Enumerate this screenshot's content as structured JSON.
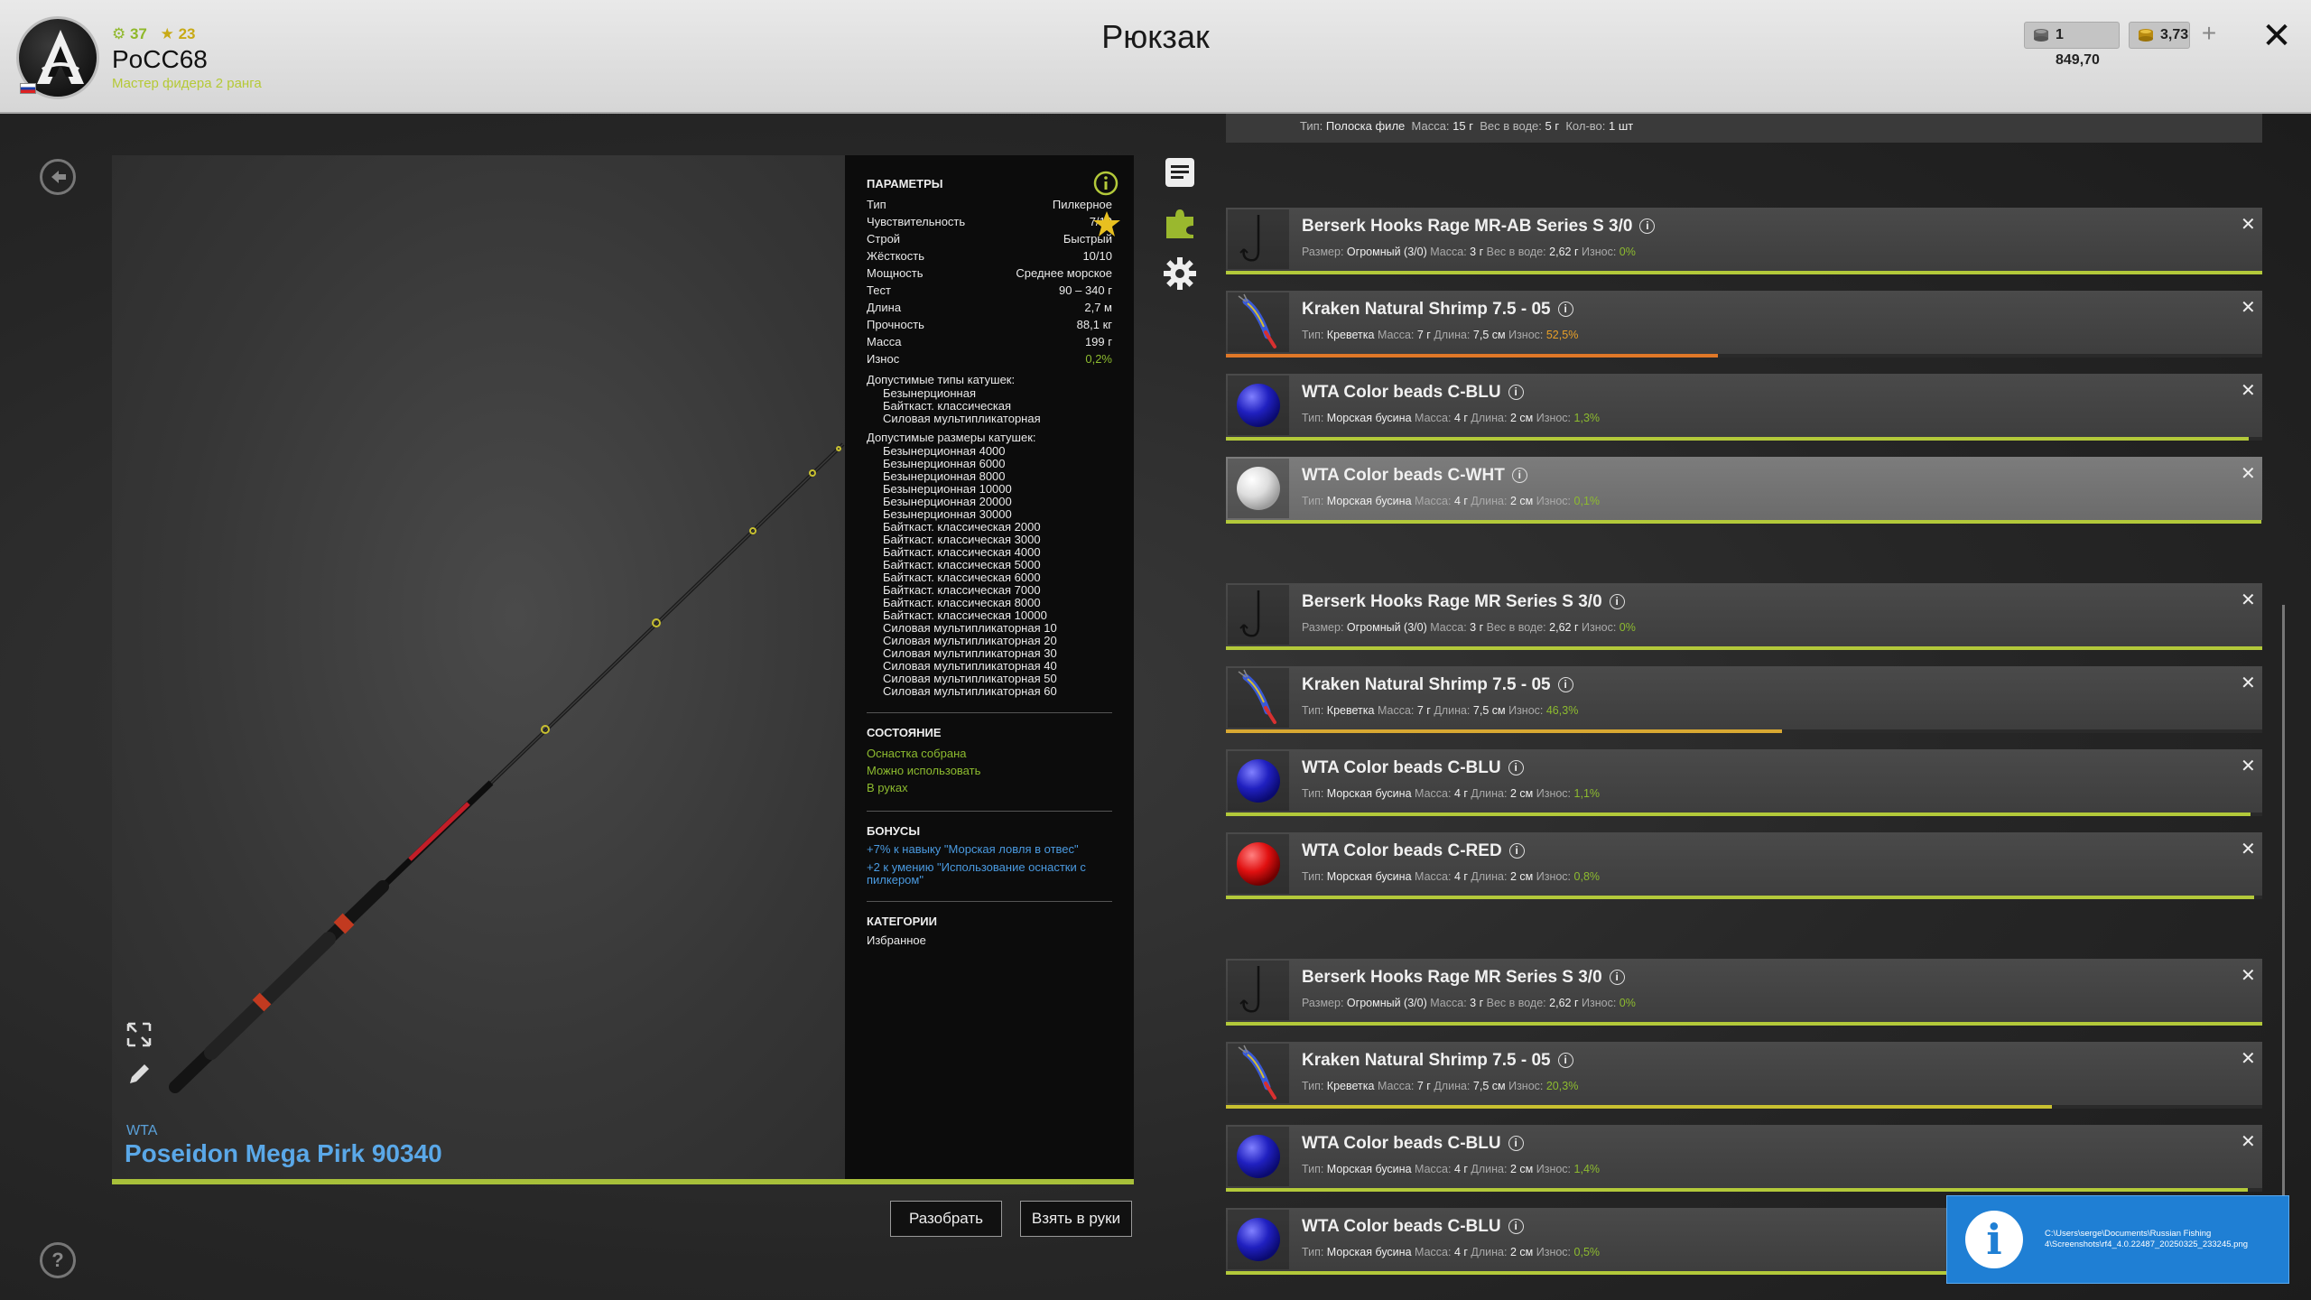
{
  "header": {
    "title": "Рюкзак",
    "player_level": "37",
    "player_stars": "23",
    "player_name": "PoCC68",
    "player_rank": "Мастер фидера 2 ранга",
    "silver": "1 849,70",
    "gold": "3,73",
    "plus": "+",
    "close": "✕"
  },
  "item": {
    "brand": "WTA",
    "name": "Poseidon Mega Pirk 90340"
  },
  "params": {
    "title": "ПАРАМЕТРЫ",
    "rows": [
      {
        "label": "Тип",
        "value": "Пилкерное"
      },
      {
        "label": "Чувствительность",
        "value": "7/10"
      },
      {
        "label": "Строй",
        "value": "Быстрый"
      },
      {
        "label": "Жёсткость",
        "value": "10/10"
      },
      {
        "label": "Мощность",
        "value": "Среднее морское"
      },
      {
        "label": "Тест",
        "value": "90 – 340 г"
      },
      {
        "label": "Длина",
        "value": "2,7 м"
      },
      {
        "label": "Прочность",
        "value": "88,1 кг"
      },
      {
        "label": "Масса",
        "value": "199 г"
      },
      {
        "label": "Износ",
        "value": "0,2%"
      }
    ],
    "reel_types_label": "Допустимые типы катушек:",
    "reel_types": [
      "Безынерционная",
      "Байткаст. классическая",
      "Силовая мультипликаторная"
    ],
    "reel_sizes_label": "Допустимые размеры катушек:",
    "reel_sizes": [
      "Безынерционная 4000",
      "Безынерционная 6000",
      "Безынерционная 8000",
      "Безынерционная 10000",
      "Безынерционная 20000",
      "Безынерционная 30000",
      "Байткаст. классическая 2000",
      "Байткаст. классическая 3000",
      "Байткаст. классическая 4000",
      "Байткаст. классическая 5000",
      "Байткаст. классическая 6000",
      "Байткаст. классическая 7000",
      "Байткаст. классическая 8000",
      "Байткаст. классическая 10000",
      "Силовая мультипликаторная 10",
      "Силовая мультипликаторная 20",
      "Силовая мультипликаторная 30",
      "Силовая мультипликаторная 40",
      "Силовая мультипликаторная 50",
      "Силовая мультипликаторная 60"
    ],
    "state_title": "СОСТОЯНИЕ",
    "state": [
      "Оснастка собрана",
      "Можно использовать",
      "В руках"
    ],
    "bonus_title": "БОНУСЫ",
    "bonuses": [
      "+7% к навыку \"Морская ловля в отвес\"",
      "+2 к умению \"Использование оснастки с пилкером\""
    ],
    "cat_title": "КАТЕГОРИИ",
    "category": "Избранное"
  },
  "actions": {
    "disassemble": "Разобрать",
    "take": "Взять в руки"
  },
  "inventory_top": {
    "type_label": "Тип:",
    "type": "Полоска филе",
    "mass_label": "Масса:",
    "mass": "15 г",
    "water_label": "Вес в воде:",
    "water": "5 г",
    "count_label": "Кол-во:",
    "count": "1 шт"
  },
  "inventory": [
    {
      "title": "Berserk Hooks Rage MR-AB Series S 3/0",
      "kind": "hook",
      "l1": "Размер:",
      "v1": "Огромный (3/0)",
      "l2": "Масса:",
      "v2": "3 г",
      "l3": "Вес в воде:",
      "v3": "2,62 г",
      "wear": "0%",
      "wear_frac": 1.0,
      "bar_color": "#b3c93a"
    },
    {
      "title": "Kraken Natural Shrimp 7.5 - 05",
      "kind": "shrimp",
      "l1": "Тип:",
      "v1": "Креветка",
      "l2": "Масса:",
      "v2": "7 г",
      "l3": "Длина:",
      "v3": "7,5 см",
      "wear": "52,5%",
      "wear_frac": 0.475,
      "bar_color": "#e07828"
    },
    {
      "title": "WTA Color beads C-BLU",
      "kind": "bead-blue",
      "l1": "Тип:",
      "v1": "Морская бусина",
      "l2": "Масса:",
      "v2": "4 г",
      "l3": "Длина:",
      "v3": "2 см",
      "wear": "1,3%",
      "wear_frac": 0.987,
      "bar_color": "#b3c93a"
    },
    {
      "title": "WTA Color beads C-WHT",
      "kind": "bead-white",
      "selected": true,
      "l1": "Тип:",
      "v1": "Морская бусина",
      "l2": "Масса:",
      "v2": "4 г",
      "l3": "Длина:",
      "v3": "2 см",
      "wear": "0,1%",
      "wear_frac": 0.999,
      "bar_color": "#b3c93a"
    },
    {
      "title": "Berserk Hooks Rage MR Series S 3/0",
      "kind": "hook",
      "l1": "Размер:",
      "v1": "Огромный (3/0)",
      "l2": "Масса:",
      "v2": "3 г",
      "l3": "Вес в воде:",
      "v3": "2,62 г",
      "wear": "0%",
      "wear_frac": 1.0,
      "bar_color": "#b3c93a"
    },
    {
      "title": "Kraken Natural Shrimp 7.5 - 05",
      "kind": "shrimp",
      "l1": "Тип:",
      "v1": "Креветка",
      "l2": "Масса:",
      "v2": "7 г",
      "l3": "Длина:",
      "v3": "7,5 см",
      "wear": "46,3%",
      "wear_frac": 0.537,
      "bar_color": "#d8a832"
    },
    {
      "title": "WTA Color beads C-BLU",
      "kind": "bead-blue",
      "l1": "Тип:",
      "v1": "Морская бусина",
      "l2": "Масса:",
      "v2": "4 г",
      "l3": "Длина:",
      "v3": "2 см",
      "wear": "1,1%",
      "wear_frac": 0.989,
      "bar_color": "#b3c93a"
    },
    {
      "title": "WTA Color beads C-RED",
      "kind": "bead-red",
      "l1": "Тип:",
      "v1": "Морская бусина",
      "l2": "Масса:",
      "v2": "4 г",
      "l3": "Длина:",
      "v3": "2 см",
      "wear": "0,8%",
      "wear_frac": 0.992,
      "bar_color": "#b3c93a"
    },
    {
      "title": "Berserk Hooks Rage MR Series S 3/0",
      "kind": "hook",
      "l1": "Размер:",
      "v1": "Огромный (3/0)",
      "l2": "Масса:",
      "v2": "3 г",
      "l3": "Вес в воде:",
      "v3": "2,62 г",
      "wear": "0%",
      "wear_frac": 1.0,
      "bar_color": "#b3c93a"
    },
    {
      "title": "Kraken Natural Shrimp 7.5 - 05",
      "kind": "shrimp",
      "l1": "Тип:",
      "v1": "Креветка",
      "l2": "Масса:",
      "v2": "7 г",
      "l3": "Длина:",
      "v3": "7,5 см",
      "wear": "20,3%",
      "wear_frac": 0.797,
      "bar_color": "#c8c030"
    },
    {
      "title": "WTA Color beads C-BLU",
      "kind": "bead-blue",
      "l1": "Тип:",
      "v1": "Морская бусина",
      "l2": "Масса:",
      "v2": "4 г",
      "l3": "Длина:",
      "v3": "2 см",
      "wear": "1,4%",
      "wear_frac": 0.986,
      "bar_color": "#b3c93a"
    },
    {
      "title": "WTA Color beads C-BLU",
      "kind": "bead-blue",
      "l1": "Тип:",
      "v1": "Морская бусина",
      "l2": "Масса:",
      "v2": "4 г",
      "l3": "Длина:",
      "v3": "2 см",
      "wear": "0,5%",
      "wear_frac": 0.995,
      "bar_color": "#b3c93a"
    }
  ],
  "notification": {
    "path": "C:\\Users\\serge\\Documents\\Russian Fishing 4\\Screenshots\\rf4_4.0.22487_20250325_233245.png"
  },
  "colors": {
    "accent_green": "#8dbb2f",
    "accent_blue": "#4a9ae0",
    "header_bg": "#dcdcdc"
  }
}
